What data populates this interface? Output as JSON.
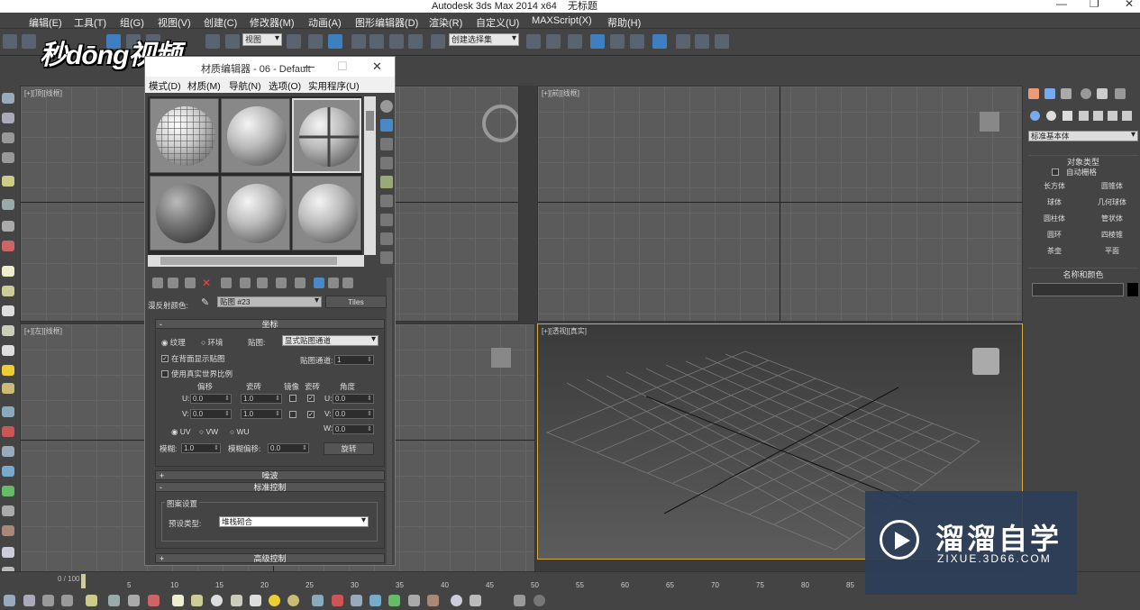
{
  "window": {
    "title": "Autodesk 3ds Max  2014 x64",
    "doc": "无标题"
  },
  "menu": [
    "编辑(E)",
    "工具(T)",
    "组(G)",
    "视图(V)",
    "创建(C)",
    "修改器(M)",
    "动画(A)",
    "图形编辑器(D)",
    "渲染(R)",
    "自定义(U)",
    "MAXScript(X)",
    "帮助(H)"
  ],
  "toolbar": {
    "view_combo": "视图",
    "selset_combo": "创建选择集"
  },
  "watermark_logo": "秒dōng视频",
  "viewports": [
    {
      "label": "[+][顶][线框]"
    },
    {
      "label": "[+][前][线框]"
    },
    {
      "label": "[+][左][线框]"
    },
    {
      "label": "[+][透视][真实]"
    }
  ],
  "right_panel": {
    "category": "标准基本体",
    "section1": "对象类型",
    "autogrid": "自动栅格",
    "buttons": [
      "长方体",
      "圆锥体",
      "球体",
      "几何球体",
      "圆柱体",
      "管状体",
      "圆环",
      "四棱锥",
      "茶壶",
      "平面"
    ],
    "section2": "名称和颜色"
  },
  "timeline": {
    "frame": "0 / 100",
    "ticks": [
      "0",
      "5",
      "10",
      "15",
      "20",
      "25",
      "30",
      "35",
      "40",
      "45",
      "50",
      "55",
      "60",
      "65",
      "70",
      "75",
      "80",
      "85"
    ]
  },
  "material_editor": {
    "title": "材质编辑器 - 06 - Default",
    "menu": [
      "模式(D)",
      "材质(M)",
      "导航(N)",
      "选项(O)",
      "实用程序(U)"
    ],
    "map_label": "漫反射颜色:",
    "map_name": "贴图 #23",
    "map_type": "Tiles",
    "rollouts": {
      "coords": "坐标",
      "noise": "噪波",
      "standard": "标准控制",
      "advanced": "高级控制"
    },
    "coords": {
      "texture": "纹理",
      "env": "环境",
      "mapping_label": "贴图:",
      "mapping_value": "显式贴图通道",
      "show_back": "在背面显示贴图",
      "channel_label": "贴图通道:",
      "channel_value": "1",
      "real_world": "使用真实世界比例",
      "offset": "偏移",
      "tiling": "瓷砖",
      "mirror": "镜像",
      "tile": "瓷砖",
      "angle": "角度",
      "u_label": "U:",
      "v_label": "V:",
      "w_label": "W:",
      "u_offset": "0.0",
      "v_offset": "0.0",
      "u_tiling": "1.0",
      "v_tiling": "1.0",
      "u_angle": "0.0",
      "v_angle": "0.0",
      "w_angle": "0.0",
      "uv": "UV",
      "vw": "VW",
      "wu": "WU",
      "blur_label": "模糊:",
      "blur_value": "1.0",
      "blur_offset_label": "模糊偏移:",
      "blur_offset_value": "0.0",
      "rotate": "旋转"
    },
    "standard": {
      "group": "图案设置",
      "preset_label": "预设类型:",
      "preset_value": "堆栈砌合"
    }
  },
  "zixue": {
    "name": "溜溜自学",
    "url": "ZIXUE.3D66.COM"
  }
}
